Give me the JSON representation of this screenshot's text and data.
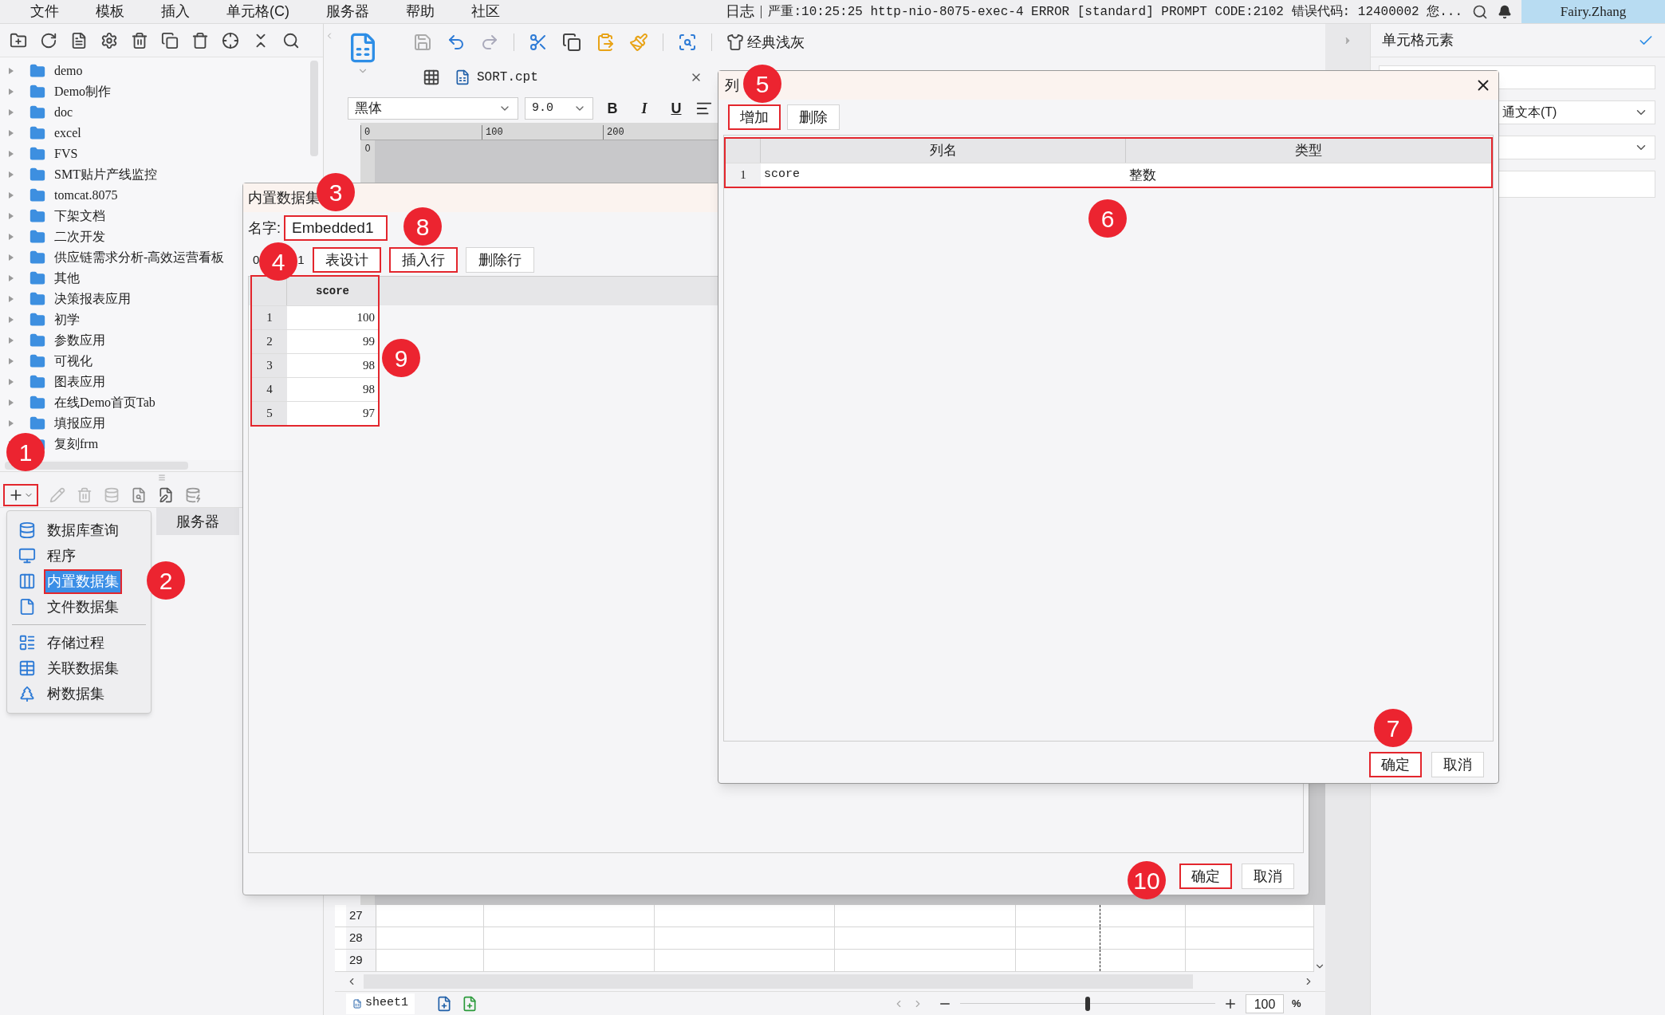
{
  "menu_bar": {
    "items": [
      "文件",
      "模板",
      "插入",
      "单元格(C)",
      "服务器",
      "帮助",
      "社区"
    ],
    "log_label": "日志",
    "log_message": "严重:10:25:25 http-nio-8075-exec-4 ERROR [standard] PROMPT CODE:2102 错误代码: 12400002 您...",
    "user": "Fairy.Zhang"
  },
  "template_tree": {
    "items": [
      {
        "label": "demo"
      },
      {
        "label": "Demo制作"
      },
      {
        "label": "doc"
      },
      {
        "label": "excel"
      },
      {
        "label": "FVS"
      },
      {
        "label": "SMT贴片产线监控"
      },
      {
        "label": "tomcat.8075"
      },
      {
        "label": "下架文档"
      },
      {
        "label": "二次开发"
      },
      {
        "label": "供应链需求分析-高效运营看板"
      },
      {
        "label": "其他"
      },
      {
        "label": "决策报表应用"
      },
      {
        "label": "初学"
      },
      {
        "label": "参数应用"
      },
      {
        "label": "可视化"
      },
      {
        "label": "图表应用"
      },
      {
        "label": "在线Demo首页Tab"
      },
      {
        "label": "填报应用"
      },
      {
        "label": "复刻frm"
      }
    ]
  },
  "dataset_panel": {
    "add_button_highlighted": true,
    "tab": "服务器"
  },
  "add_menu": {
    "groups": [
      [
        {
          "label": "数据库查询",
          "selected": false,
          "highlighted": false
        },
        {
          "label": "程序",
          "selected": false,
          "highlighted": false
        },
        {
          "label": "内置数据集",
          "selected": true,
          "highlighted": true
        },
        {
          "label": "文件数据集",
          "selected": false,
          "highlighted": false
        }
      ],
      [
        {
          "label": "存储过程",
          "selected": false,
          "highlighted": false
        },
        {
          "label": "关联数据集",
          "selected": false,
          "highlighted": false
        },
        {
          "label": "树数据集",
          "selected": false,
          "highlighted": false
        }
      ]
    ]
  },
  "designer": {
    "theme_button": "经典浅灰",
    "tab": "SORT.cpt",
    "font": "黑体",
    "font_size": "9.0",
    "format_buttons": [
      "B",
      "I",
      "U"
    ],
    "ruler_marks": [
      "0",
      "100",
      "200"
    ],
    "vertical_ruler_mark": "0"
  },
  "sheet": {
    "rows": [
      "27",
      "28",
      "29"
    ],
    "sheet_tab": "sheet1",
    "zoom": {
      "level": 0.5,
      "value": "100",
      "unit": "%"
    }
  },
  "right_panel": {
    "title": "单元格元素",
    "type_select": "通文本(T)"
  },
  "embedded_dialog": {
    "title": "内置数据集",
    "name_label": "名字:",
    "name_value": "Embedded1",
    "name_highlighted": true,
    "counter": [
      "0",
      "1"
    ],
    "buttons": [
      {
        "label": "表设计",
        "highlighted": true
      },
      {
        "label": "插入行",
        "highlighted": true
      },
      {
        "label": "删除行",
        "highlighted": false
      }
    ],
    "table": {
      "highlighted": true,
      "columns": [
        "score"
      ],
      "rows": [
        {
          "index": "1",
          "value": "100"
        },
        {
          "index": "2",
          "value": "99"
        },
        {
          "index": "3",
          "value": "98"
        },
        {
          "index": "4",
          "value": "98"
        },
        {
          "index": "5",
          "value": "97"
        }
      ]
    },
    "footer": [
      {
        "label": "确定",
        "highlighted": true
      },
      {
        "label": "取消",
        "highlighted": false
      }
    ]
  },
  "column_dialog": {
    "title": "列",
    "buttons": [
      {
        "label": "增加",
        "highlighted": true
      },
      {
        "label": "删除",
        "highlighted": false
      }
    ],
    "table": {
      "highlighted": true,
      "columns": [
        "列名",
        "类型"
      ],
      "rows": [
        {
          "index": "1",
          "name": "score",
          "type": "整数"
        }
      ]
    },
    "footer": [
      {
        "label": "确定",
        "highlighted": true
      },
      {
        "label": "取消",
        "highlighted": false
      }
    ]
  },
  "callouts": [
    "1",
    "2",
    "3",
    "4",
    "5",
    "6",
    "7",
    "8",
    "9",
    "10"
  ]
}
